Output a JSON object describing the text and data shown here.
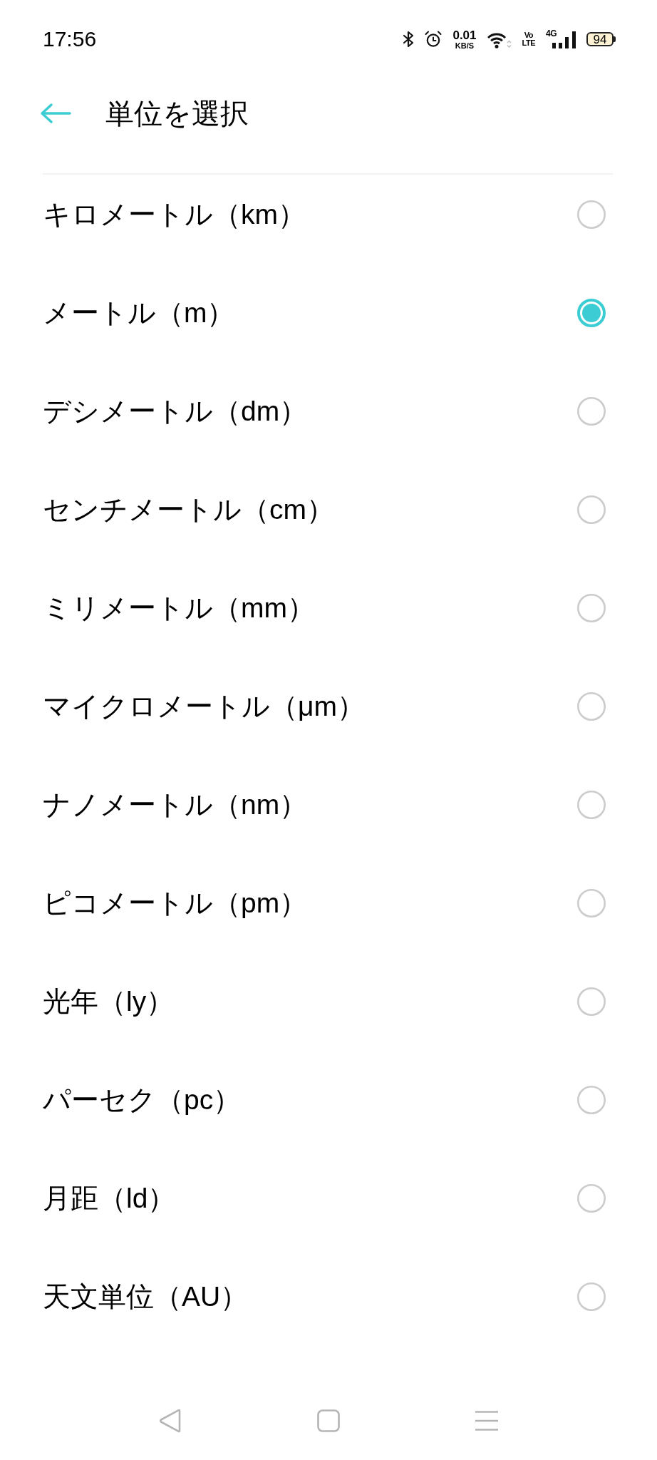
{
  "status_bar": {
    "time": "17:56",
    "net_speed": "0.01",
    "net_speed_unit": "KB/S",
    "volte": [
      "Vo",
      "LTE"
    ],
    "network_type": "4G",
    "battery": "94"
  },
  "header": {
    "title": "単位を選択"
  },
  "units": [
    {
      "label": "キロメートル（km）",
      "selected": false
    },
    {
      "label": "メートル（m）",
      "selected": true
    },
    {
      "label": "デシメートル（dm）",
      "selected": false
    },
    {
      "label": "センチメートル（cm）",
      "selected": false
    },
    {
      "label": "ミリメートル（mm）",
      "selected": false
    },
    {
      "label": "マイクロメートル（μm）",
      "selected": false
    },
    {
      "label": "ナノメートル（nm）",
      "selected": false
    },
    {
      "label": "ピコメートル（pm）",
      "selected": false
    },
    {
      "label": "光年（ly）",
      "selected": false
    },
    {
      "label": "パーセク（pc）",
      "selected": false
    },
    {
      "label": "月距（ld）",
      "selected": false
    },
    {
      "label": "天文単位（AU）",
      "selected": false
    }
  ]
}
